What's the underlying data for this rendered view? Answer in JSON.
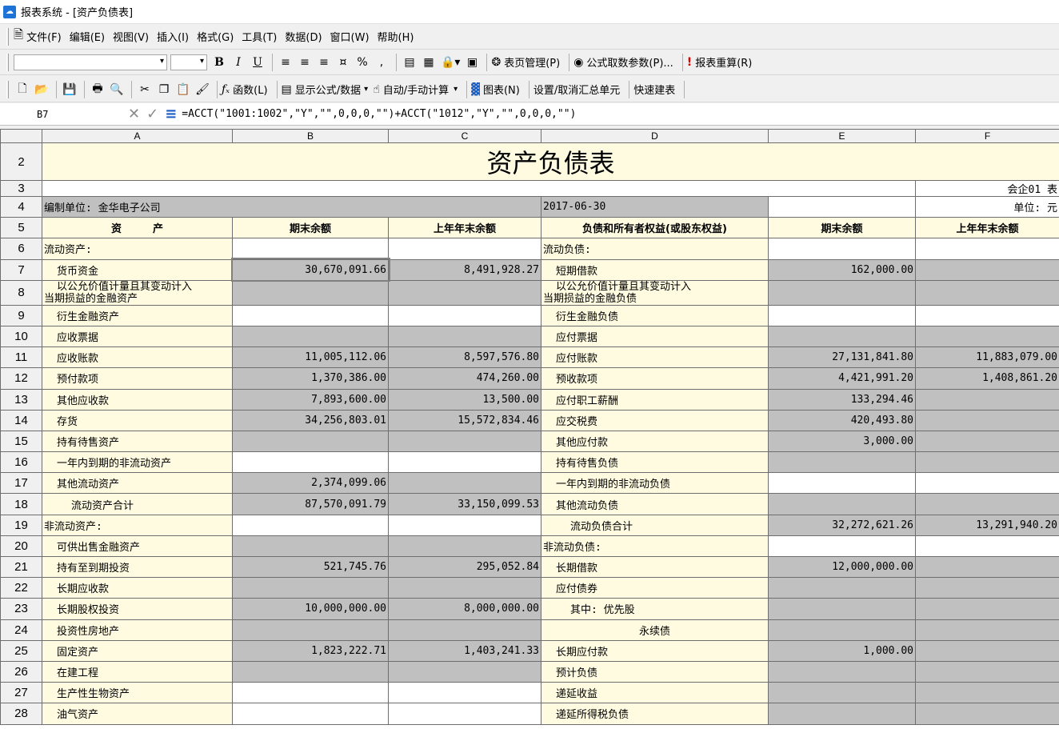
{
  "window": {
    "title": "报表系统 - [资产负债表]"
  },
  "menubar": {
    "items": [
      "文件(F)",
      "编辑(E)",
      "视图(V)",
      "插入(I)",
      "格式(G)",
      "工具(T)",
      "数据(D)",
      "窗口(W)",
      "帮助(H)"
    ]
  },
  "toolbar1": {
    "bold": "B",
    "italic": "I",
    "underline": "U",
    "percent": "%",
    "comma": ",",
    "page_mgmt": "表页管理(P)",
    "formula_params": "公式取数参数(P)...",
    "recalc": "报表重算(R)"
  },
  "toolbar2": {
    "functions": "函数(L)",
    "show_formula": "显示公式/数据",
    "auto_manual": "自动/手动计算",
    "chart": "图表(N)",
    "toggle_summary": "设置/取消汇总单元",
    "quick_build": "快速建表"
  },
  "formula_bar": {
    "cell_ref": "B7",
    "formula": "=ACCT(\"1001:1002\",\"Y\",\"\",0,0,0,\"\")+ACCT(\"1012\",\"Y\",\"\",0,0,0,\"\")"
  },
  "sheet": {
    "columns": [
      "A",
      "B",
      "C",
      "D",
      "E",
      "F"
    ],
    "title": "资产负债表",
    "form_code": "会企01 表",
    "unit": "单位: 元",
    "company": "编制单位: 金华电子公司",
    "date": "2017-06-30",
    "header": {
      "asset": "资　　　产",
      "end_balance": "期末余额",
      "prior_balance": "上年年末余额",
      "liab": "负债和所有者权益(或股东权益)",
      "end_balance2": "期末余额",
      "prior_balance2": "上年年末余额"
    },
    "rows": [
      {
        "num": "6",
        "a": "流动资产:",
        "b": "",
        "c": "",
        "d": "流动负债:",
        "e": "",
        "f": ""
      },
      {
        "num": "7",
        "a": "货币资金",
        "b": "30,670,091.66",
        "c": "8,491,928.27",
        "d": "短期借款",
        "e": "162,000.00",
        "f": ""
      },
      {
        "num": "8",
        "a": "以公允价值计量且其变动计入",
        "a2": "当期损益的金融资产",
        "b": "",
        "c": "",
        "d": "以公允价值计量且其变动计入",
        "d2": "当期损益的金融负债",
        "e": "",
        "f": ""
      },
      {
        "num": "9",
        "a": "衍生金融资产",
        "b": "",
        "c": "",
        "d": "衍生金融负债",
        "e": "",
        "f": ""
      },
      {
        "num": "10",
        "a": "应收票据",
        "b": "",
        "c": "",
        "d": "应付票据",
        "e": "",
        "f": ""
      },
      {
        "num": "11",
        "a": "应收账款",
        "b": "11,005,112.06",
        "c": "8,597,576.80",
        "d": "应付账款",
        "e": "27,131,841.80",
        "f": "11,883,079.00"
      },
      {
        "num": "12",
        "a": "预付款项",
        "b": "1,370,386.00",
        "c": "474,260.00",
        "d": "预收款项",
        "e": "4,421,991.20",
        "f": "1,408,861.20"
      },
      {
        "num": "13",
        "a": "其他应收款",
        "b": "7,893,600.00",
        "c": "13,500.00",
        "d": "应付职工薪酬",
        "e": "133,294.46",
        "f": ""
      },
      {
        "num": "14",
        "a": "存货",
        "b": "34,256,803.01",
        "c": "15,572,834.46",
        "d": "应交税费",
        "e": "420,493.80",
        "f": ""
      },
      {
        "num": "15",
        "a": "持有待售资产",
        "b": "",
        "c": "",
        "d": "其他应付款",
        "e": "3,000.00",
        "f": ""
      },
      {
        "num": "16",
        "a": "一年内到期的非流动资产",
        "b": "",
        "c": "",
        "d": "持有待售负债",
        "e": "",
        "f": ""
      },
      {
        "num": "17",
        "a": "其他流动资产",
        "b": "2,374,099.06",
        "c": "",
        "d": "一年内到期的非流动负债",
        "e": "",
        "f": ""
      },
      {
        "num": "18",
        "a": "流动资产合计",
        "b": "87,570,091.79",
        "c": "33,150,099.53",
        "d": "其他流动负债",
        "e": "",
        "f": ""
      },
      {
        "num": "19",
        "a": "非流动资产:",
        "b": "",
        "c": "",
        "d": "流动负债合计",
        "e": "32,272,621.26",
        "f": "13,291,940.20"
      },
      {
        "num": "20",
        "a": "可供出售金融资产",
        "b": "",
        "c": "",
        "d": "非流动负债:",
        "e": "",
        "f": ""
      },
      {
        "num": "21",
        "a": "持有至到期投资",
        "b": "521,745.76",
        "c": "295,052.84",
        "d": "长期借款",
        "e": "12,000,000.00",
        "f": ""
      },
      {
        "num": "22",
        "a": "长期应收款",
        "b": "",
        "c": "",
        "d": "应付债券",
        "e": "",
        "f": ""
      },
      {
        "num": "23",
        "a": "长期股权投资",
        "b": "10,000,000.00",
        "c": "8,000,000.00",
        "d": "其中: 优先股",
        "e": "",
        "f": ""
      },
      {
        "num": "24",
        "a": "投资性房地产",
        "b": "",
        "c": "",
        "d": "永续债",
        "e": "",
        "f": ""
      },
      {
        "num": "25",
        "a": "固定资产",
        "b": "1,823,222.71",
        "c": "1,403,241.33",
        "d": "长期应付款",
        "e": "1,000.00",
        "f": ""
      },
      {
        "num": "26",
        "a": "在建工程",
        "b": "",
        "c": "",
        "d": "预计负债",
        "e": "",
        "f": ""
      },
      {
        "num": "27",
        "a": "生产性生物资产",
        "b": "",
        "c": "",
        "d": "递延收益",
        "e": "",
        "f": ""
      },
      {
        "num": "28",
        "a": "油气资产",
        "b": "",
        "c": "",
        "d": "递延所得税负债",
        "e": "",
        "f": ""
      }
    ]
  }
}
